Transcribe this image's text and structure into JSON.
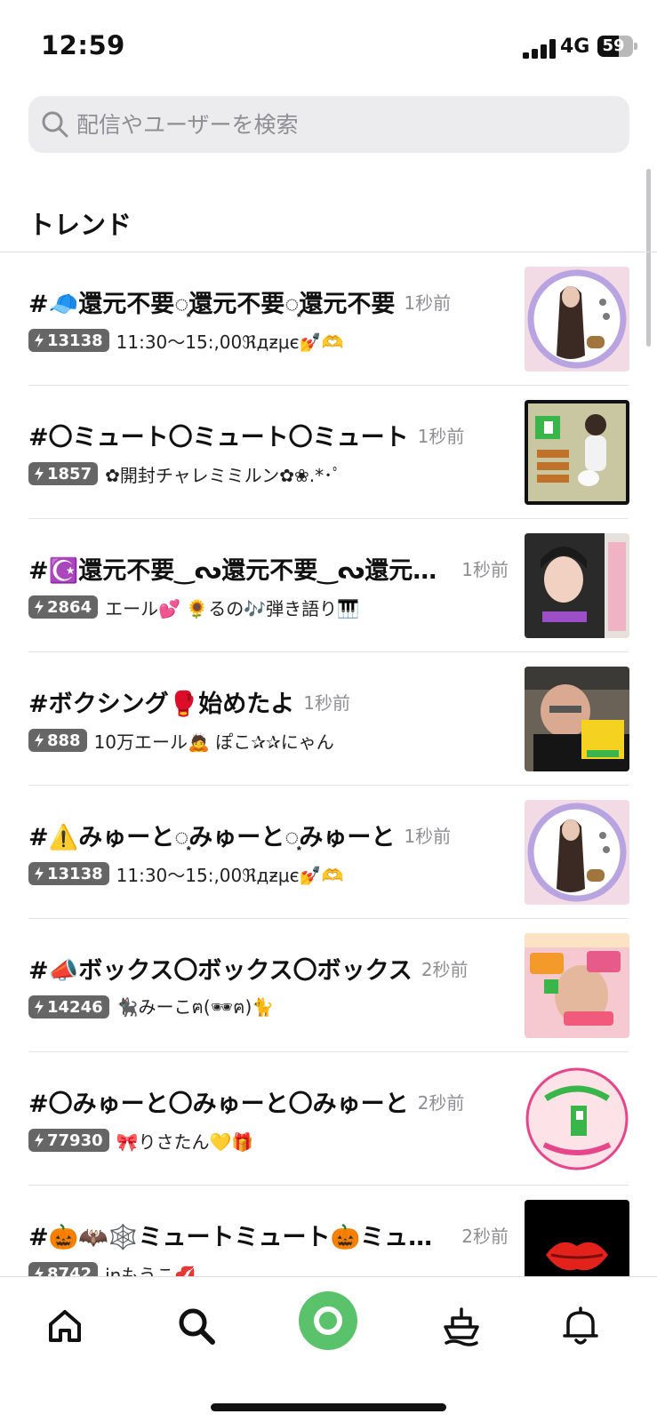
{
  "status_bar": {
    "time": "12:59",
    "network": "4G",
    "battery_level": "59"
  },
  "search": {
    "placeholder": "配信やユーザーを検索"
  },
  "section": {
    "title": "トレンド"
  },
  "trends": [
    {
      "title": "#🧢還元不要◌͙還元不要◌͙還元不要",
      "time": "1秒前",
      "count": "13138",
      "description": "11:30～15:,00ℜдƶμє💅🫶",
      "thumbnail": "portrait-circle-frame"
    },
    {
      "title": "#〇ミュート〇ミュート〇ミュート",
      "time": "1秒前",
      "count": "1857",
      "description": "✿開封チャレミミルン✿❀.*･ﾟ",
      "thumbnail": "box-box-vox-poster"
    },
    {
      "title": "#☪️還元不要‿ᔓ還元不要‿ᔓ還元不要",
      "time": "1秒前",
      "count": "2864",
      "description": "エール💕 🌻るの🎶弾き語り🎹",
      "thumbnail": "singing-live-poster"
    },
    {
      "title": "#ボクシング🥊始めたよ",
      "time": "1秒前",
      "count": "888",
      "description": "10万エール🙇 ぽこ✰✰にゃん",
      "thumbnail": "boxing-selfie"
    },
    {
      "title": "#⚠️みゅーと◌͙みゅーと◌͙みゅーと",
      "time": "1秒前",
      "count": "13138",
      "description": "11:30～15:,00ℜдƶμє💅🫶",
      "thumbnail": "portrait-circle-frame"
    },
    {
      "title": "#📣ボックス〇ボックス〇ボックス",
      "time": "2秒前",
      "count": "14246",
      "description": "🐈‍⬛みーこฅ(🕶ฅ)🐈",
      "thumbnail": "laugh-song-poster"
    },
    {
      "title": "#〇みゅーと〇みゅーと〇みゅーと",
      "time": "2秒前",
      "count": "77930",
      "description": "🎀りさたん💛🎁",
      "thumbnail": "risatan-free-badge"
    },
    {
      "title": "#🎃🦇🕸️ミュートミュート🎃ミュート",
      "time": "2秒前",
      "count": "8742",
      "description": "inもうこ💋",
      "thumbnail": "red-lips"
    }
  ],
  "nav": {
    "items": [
      "home-icon",
      "search-icon",
      "live-broadcast-icon",
      "ship-icon",
      "bell-icon"
    ],
    "live_color": "#5ac26a"
  },
  "colors": {
    "badge_bg": "#666666",
    "search_bg": "#ececee",
    "accent_green": "#5ac26a"
  }
}
